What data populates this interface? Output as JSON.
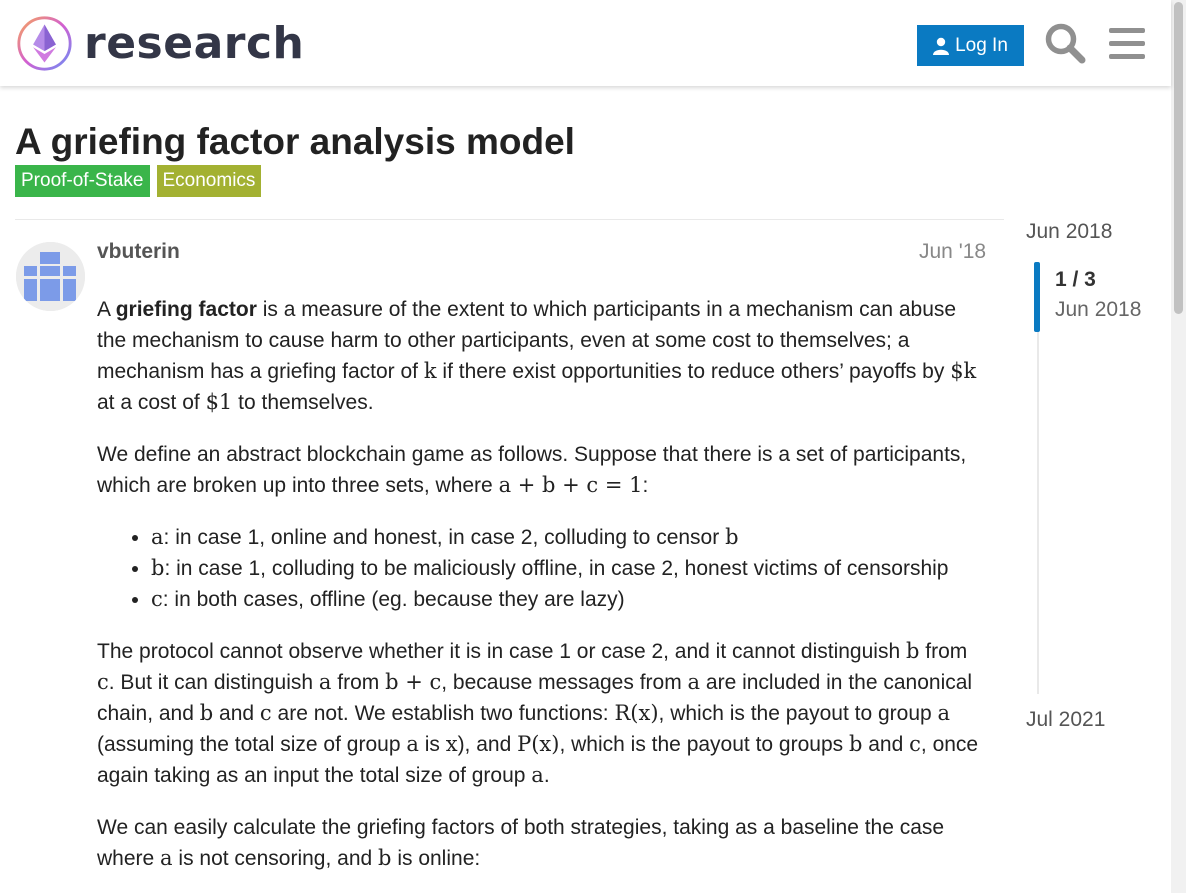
{
  "header": {
    "site_name": "research",
    "login_label": "Log In",
    "colors": {
      "accent": "#0a7ac2",
      "logo_text": "#333647"
    }
  },
  "topic": {
    "title": "A griefing factor analysis model",
    "tags": [
      {
        "label": "Proof-of-Stake",
        "color": "#3ab54a"
      },
      {
        "label": "Economics",
        "color": "#a3b132"
      }
    ]
  },
  "post": {
    "author": "vbuterin",
    "date": "Jun '18",
    "p1": {
      "a": "A ",
      "b": "griefing factor",
      "c": " is a measure of the extent to which participants in a mechanism can abuse the mechanism to cause harm to other participants, even at some cost to themselves; a mechanism has a griefing factor of ",
      "k": "k",
      "d": " if there exist opportunities to reduce others’ payoffs by ",
      "dk": "$k",
      "e": " at a cost of ",
      "d1": "$1",
      "f": " to themselves."
    },
    "p2": {
      "a": "We define an abstract blockchain game as follows. Suppose that there is a set of participants, which are broken up into three sets, where ",
      "eq": "a + b + c = 1",
      "b": ":"
    },
    "list": [
      {
        "var": "a",
        "text": ": in case 1, online and honest, in case 2, colluding to censor ",
        "var2": "b"
      },
      {
        "var": "b",
        "text": ": in case 1, colluding to be maliciously offline, in case 2, honest victims of censorship",
        "var2": ""
      },
      {
        "var": "c",
        "text": ": in both cases, offline (eg. because they are lazy)",
        "var2": ""
      }
    ],
    "p3": {
      "t1": "The protocol cannot observe whether it is in case 1 or case 2, and it cannot distinguish ",
      "m1": "b",
      "t2": " from ",
      "m2": "c",
      "t3": ". But it can distinguish ",
      "m3": "a",
      "t4": " from ",
      "m4": "b + c",
      "t5": ", because messages from ",
      "m5": "a",
      "t6": " are included in the canonical chain, and ",
      "m6": "b",
      "t7": " and ",
      "m7": "c",
      "t8": " are not. We establish two functions: ",
      "m8": "R(x)",
      "t9": ", which is the payout to group ",
      "m9": "a",
      "t10": " (assuming the total size of group ",
      "m10": "a",
      "t11": " is ",
      "m11": "x",
      "t12": "), and ",
      "m12": "P(x)",
      "t13": ", which is the payout to groups ",
      "m13": "b",
      "t14": " and ",
      "m14": "c",
      "t15": ", once again taking as an input the total size of group ",
      "m15": "a",
      "t16": "."
    },
    "p4": {
      "t1": "We can easily calculate the griefing factors of both strategies, taking as a baseline the case where ",
      "m1": "a",
      "t2": " is not censoring, and ",
      "m2": "b",
      "t3": " is online:"
    }
  },
  "timeline": {
    "start": "Jun 2018",
    "count": "1 / 3",
    "current_date": "Jun 2018",
    "end": "Jul 2021"
  }
}
